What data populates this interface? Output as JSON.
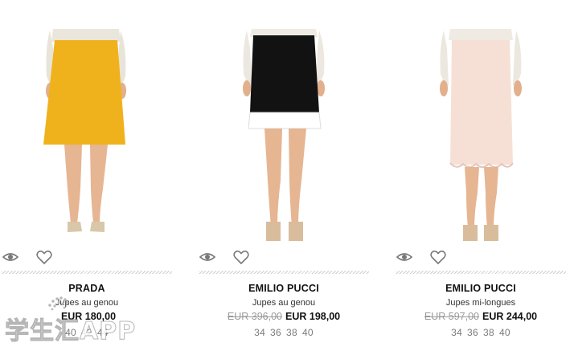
{
  "products": [
    {
      "brand": "PRADA",
      "category": "Jupes au genou",
      "old_price": "",
      "new_price": "EUR 180,00",
      "sizes": [
        "40",
        "42",
        "44"
      ],
      "skirt_color": "#f0b21c",
      "swatches": [
        "#8a7a5a",
        "#334a5a"
      ]
    },
    {
      "brand": "EMILIO PUCCI",
      "category": "Jupes au genou",
      "old_price": "EUR 396,00",
      "new_price": "EUR 198,00",
      "sizes": [
        "34",
        "36",
        "38",
        "40"
      ],
      "skirt_color": "#121212",
      "swatches": [
        "#111111",
        "#b43a3a"
      ]
    },
    {
      "brand": "EMILIO PUCCI",
      "category": "Jupes mi-longues",
      "old_price": "EUR 597,00",
      "new_price": "EUR 244,00",
      "sizes": [
        "34",
        "36",
        "38",
        "40"
      ],
      "skirt_color": "#f6e0d6",
      "swatches": [
        "#e7c9c0",
        "#222222"
      ]
    }
  ],
  "watermark": {
    "text": "学生汇APP"
  },
  "icons": {
    "quick_view": "eye-icon",
    "wishlist": "heart-icon"
  }
}
